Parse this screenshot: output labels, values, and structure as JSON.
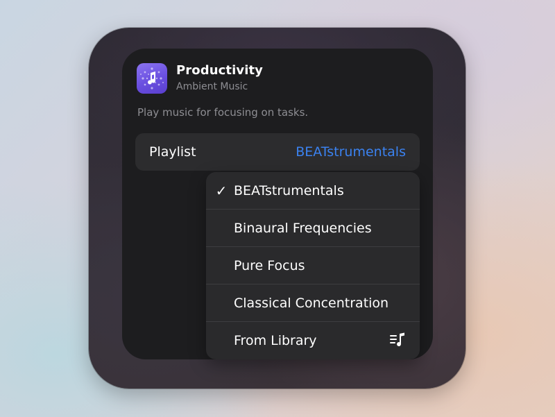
{
  "app": {
    "title": "Productivity",
    "subtitle": "Ambient Music",
    "description": "Play music for focusing on tasks.",
    "icon": "music-note-icon",
    "icon_color": "#7a5fe8"
  },
  "parameter": {
    "label": "Playlist",
    "value": "BEATstrumentals",
    "value_color": "#3b82f0"
  },
  "menu": {
    "items": [
      {
        "label": "BEATstrumentals",
        "selected": true,
        "check": "✓"
      },
      {
        "label": "Binaural Frequencies",
        "selected": false
      },
      {
        "label": "Pure Focus",
        "selected": false
      },
      {
        "label": "Classical Concentration",
        "selected": false
      },
      {
        "label": "From Library",
        "selected": false,
        "icon": "music-library-icon"
      }
    ]
  }
}
